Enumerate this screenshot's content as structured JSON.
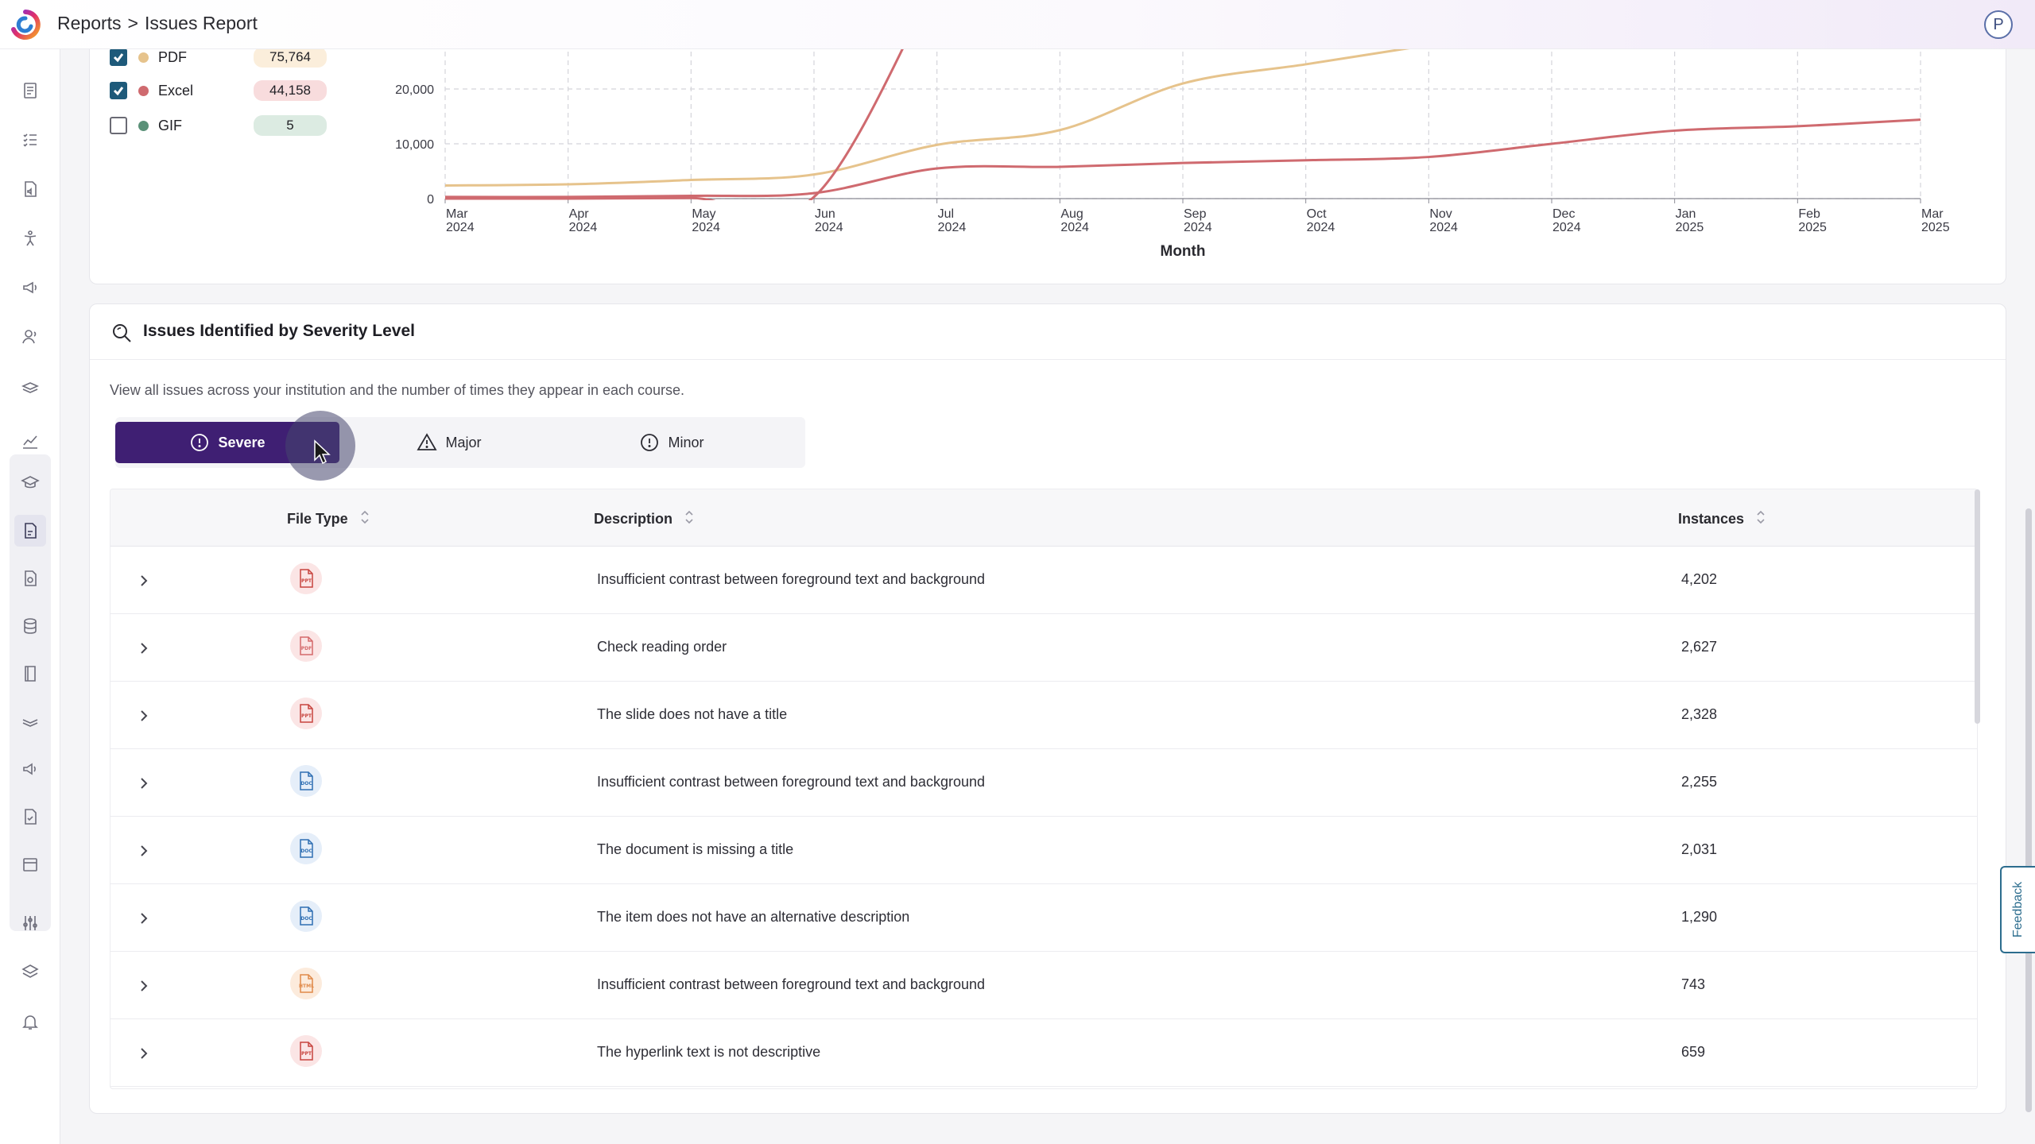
{
  "header": {
    "breadcrumb_root": "Reports",
    "breadcrumb_sep": ">",
    "breadcrumb_current": "Issues Report",
    "avatar_initial": "P"
  },
  "sidebar": {
    "icons": [
      "content-icon",
      "checklist-icon",
      "file-audio-icon",
      "accessibility-icon",
      "megaphone-icon",
      "users-icon",
      "course-icon",
      "chart-line-icon",
      "graduation-cap-icon",
      "file-report-icon",
      "file-search-icon",
      "database-icon",
      "book-icon",
      "learning-icon",
      "speaker-icon",
      "file-audit-icon",
      "calendar-icon",
      "sliders-icon",
      "layers-icon",
      "bell-icon"
    ],
    "active": "file-report-icon"
  },
  "legend": [
    {
      "label": "PDF",
      "count": "75,764",
      "checked": true,
      "color": "#e6c38c",
      "pill": "#fbeedb"
    },
    {
      "label": "Excel",
      "count": "44,158",
      "checked": true,
      "color": "#cf6a6f",
      "pill": "#f8dcdd"
    },
    {
      "label": "GIF",
      "count": "5",
      "checked": false,
      "color": "#5a9178",
      "pill": "#dcebe2"
    }
  ],
  "chart_data": {
    "type": "line",
    "xlabel": "Month",
    "ylabel": "",
    "x": [
      "Mar 2024",
      "Apr 2024",
      "May 2024",
      "Jun 2024",
      "Jul 2024",
      "Aug 2024",
      "Sep 2024",
      "Oct 2024",
      "Nov 2024",
      "Dec 2024",
      "Jan 2025",
      "Feb 2025",
      "Mar 2025"
    ],
    "yticks": [
      "0",
      "10,000",
      "20,000"
    ],
    "ylim": [
      0,
      27500
    ],
    "grid": true,
    "series": [
      {
        "name": "PDF",
        "color": "#e6c38c",
        "values": [
          2400,
          2600,
          3400,
          4400,
          9800,
          12500,
          21000,
          24500,
          28000,
          null,
          null,
          null,
          null
        ]
      },
      {
        "name": "Excel",
        "color": "#cf6a6f",
        "values": [
          300,
          300,
          500,
          1000,
          5500,
          5800,
          6500,
          7000,
          7600,
          10000,
          12400,
          13200,
          14400
        ]
      },
      {
        "name": "",
        "color": "#cf6a6f",
        "values": [
          0,
          0,
          100,
          300,
          40000,
          null,
          null,
          null,
          null,
          null,
          null,
          null,
          null
        ]
      }
    ]
  },
  "issues": {
    "title": "Issues Identified by Severity Level",
    "description": "View all issues across your institution and the number of times they appear in each course.",
    "tabs": {
      "severe": "Severe",
      "major": "Major",
      "minor": "Minor"
    },
    "columns": {
      "file_type": "File Type",
      "description": "Description",
      "instances": "Instances"
    },
    "rows": [
      {
        "file_type": "PPT",
        "description": "Insufficient contrast between foreground text and background",
        "instances": "4,202"
      },
      {
        "file_type": "PDF",
        "description": "Check reading order",
        "instances": "2,627"
      },
      {
        "file_type": "PPT",
        "description": "The slide does not have a title",
        "instances": "2,328"
      },
      {
        "file_type": "DOC",
        "description": "Insufficient contrast between foreground text and background",
        "instances": "2,255"
      },
      {
        "file_type": "DOC",
        "description": "The document is missing a title",
        "instances": "2,031"
      },
      {
        "file_type": "DOC",
        "description": "The item does not have an alternative description",
        "instances": "1,290"
      },
      {
        "file_type": "HTML",
        "description": "Insufficient contrast between foreground text and background",
        "instances": "743"
      },
      {
        "file_type": "PPT",
        "description": "The hyperlink text is not descriptive",
        "instances": "659"
      }
    ]
  },
  "feedback_label": "Feedback",
  "colors": {
    "accent": "#3f1f73",
    "check": "#1e5a7a",
    "feedback": "#2c6d8e"
  }
}
